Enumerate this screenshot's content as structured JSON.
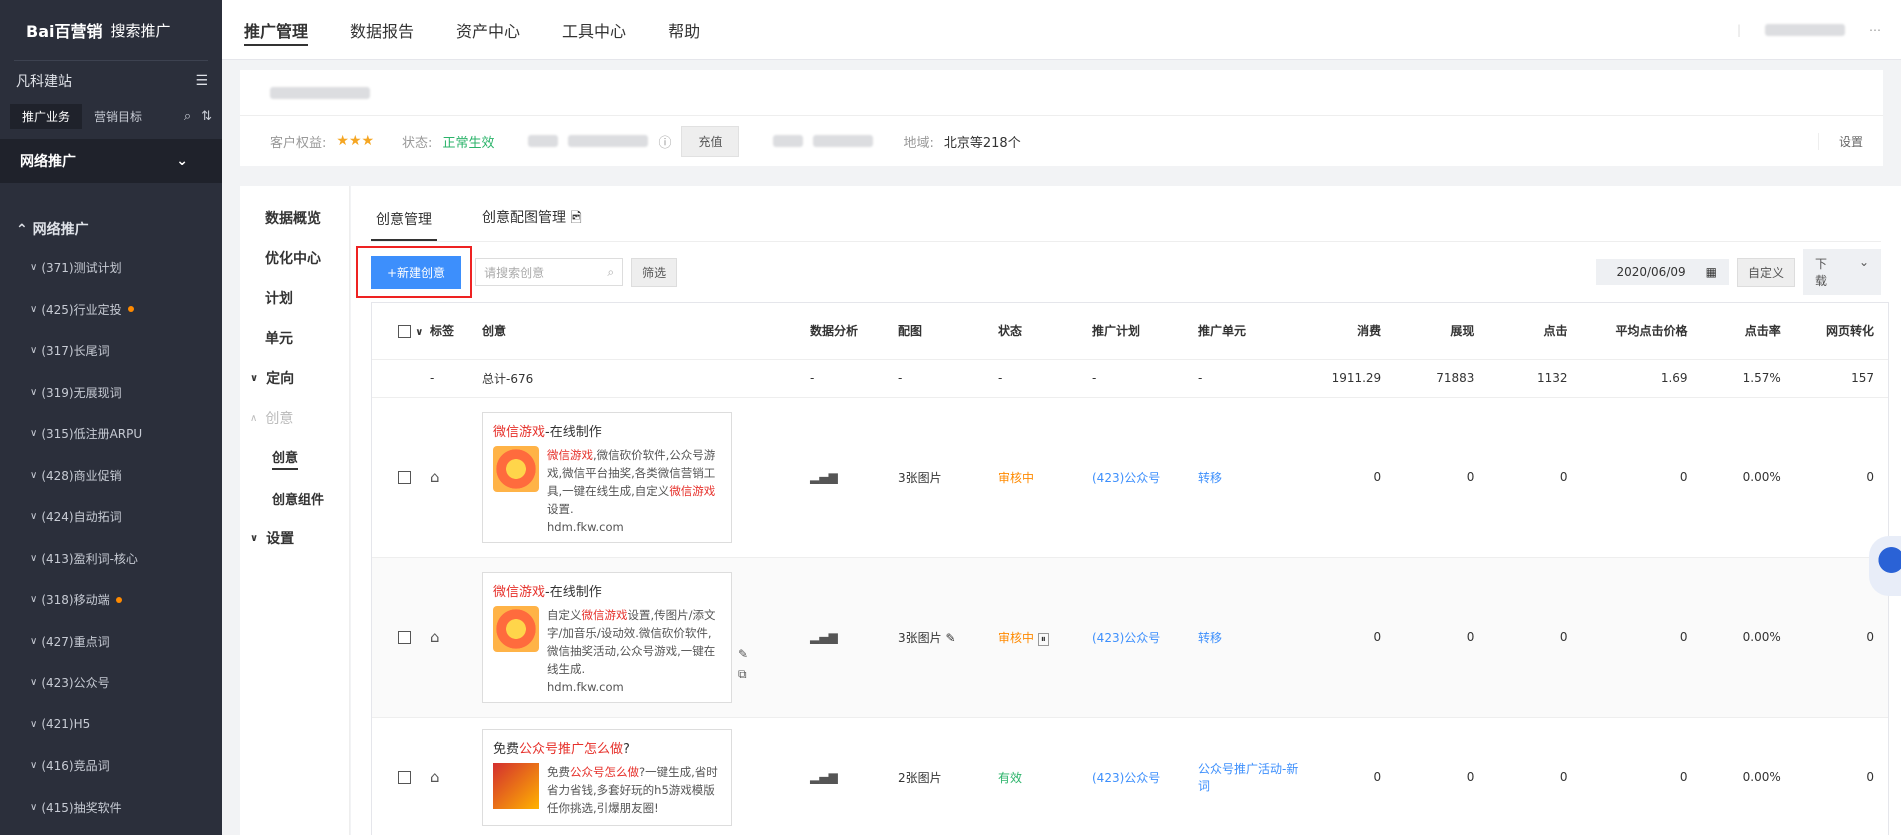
{
  "brand": {
    "logo_text": "Bai百营销",
    "product": "搜索推广"
  },
  "sidebar": {
    "site_name": "凡科建站",
    "tabs": [
      "推广业务",
      "营销目标"
    ],
    "section": "网络推广",
    "group": "网络推广",
    "items": [
      {
        "label": "(371)测试计划",
        "dot": false
      },
      {
        "label": "(425)行业定投",
        "dot": true
      },
      {
        "label": "(317)长尾词",
        "dot": false
      },
      {
        "label": "(319)无展现词",
        "dot": false
      },
      {
        "label": "(315)低注册ARPU",
        "dot": false
      },
      {
        "label": "(428)商业促销",
        "dot": false
      },
      {
        "label": "(424)自动拓词",
        "dot": false
      },
      {
        "label": "(413)盈利词-核心",
        "dot": false
      },
      {
        "label": "(318)移动端",
        "dot": true
      },
      {
        "label": "(427)重点词",
        "dot": false
      },
      {
        "label": "(423)公众号",
        "dot": false
      },
      {
        "label": "(421)H5",
        "dot": false
      },
      {
        "label": "(416)竞品词",
        "dot": false
      },
      {
        "label": "(415)抽奖软件",
        "dot": false
      }
    ]
  },
  "topnav": {
    "items": [
      "推广管理",
      "数据报告",
      "资产中心",
      "工具中心",
      "帮助"
    ]
  },
  "account": {
    "rights_label": "客户权益:",
    "status_label": "状态:",
    "status_value": "正常生效",
    "recharge": "充值",
    "region_label": "地域:",
    "region_value": "北京等218个",
    "settings": "设置"
  },
  "subnav": {
    "items": [
      "数据概览",
      "优化中心",
      "计划",
      "单元",
      "定向",
      "创意",
      "创意",
      "创意组件",
      "设置"
    ]
  },
  "main": {
    "tabs": [
      "创意管理",
      "创意配图管理"
    ],
    "new_button": "+新建创意",
    "search_placeholder": "请搜索创意",
    "filter_button": "筛选",
    "date": "2020/06/09",
    "custom_button": "自定义",
    "download_button": "下载"
  },
  "table": {
    "headers": [
      "标签",
      "创意",
      "数据分析",
      "配图",
      "状态",
      "推广计划",
      "推广单元",
      "消费",
      "展现",
      "点击",
      "平均点击价格",
      "点击率",
      "网页转化"
    ],
    "total": {
      "tag": "-",
      "idea": "总计-676",
      "analysis": "-",
      "img": "-",
      "status": "-",
      "plan": "-",
      "unit": "-",
      "cost": "1911.29",
      "impr": "71883",
      "click": "1132",
      "cpc": "1.69",
      "ctr": "1.57%",
      "conv": "157"
    },
    "rows": [
      {
        "title_red": "微信游戏",
        "title_rest": "-在线制作",
        "desc": [
          {
            "t": "微信游戏",
            "red": true
          },
          {
            "t": ",微信砍价软件,公众号游戏,微信平台抽奖,各类微信营销工具,一键在线生成,自定义",
            "red": false
          },
          {
            "t": "微信游戏",
            "red": true
          },
          {
            "t": "设置.",
            "red": false
          }
        ],
        "url": "hdm.fkw.com",
        "img": "3张图片",
        "status": "审核中",
        "plan": "(423)公众号",
        "unit": "转移",
        "cost": "0",
        "impr": "0",
        "click": "0",
        "cpc": "0",
        "ctr": "0.00%",
        "conv": "0"
      },
      {
        "title_red": "微信游戏",
        "title_rest": "-在线制作",
        "desc": [
          {
            "t": "自定义",
            "red": false
          },
          {
            "t": "微信游戏",
            "red": true
          },
          {
            "t": "设置,传图片/添文字/加音乐/设动效.微信砍价软件,微信抽奖活动,公众号游戏,一键在线生成.",
            "red": false
          }
        ],
        "url": "hdm.fkw.com",
        "img": "3张图片",
        "status": "审核中",
        "plan": "(423)公众号",
        "unit": "转移",
        "cost": "0",
        "impr": "0",
        "click": "0",
        "cpc": "0",
        "ctr": "0.00%",
        "conv": "0"
      },
      {
        "title_pre": "免费",
        "title_red": "公众号推广怎么做",
        "title_rest": "?",
        "desc": [
          {
            "t": "免费",
            "red": false
          },
          {
            "t": "公众号怎么做",
            "red": true
          },
          {
            "t": "?一键生成,省时省力省钱,多套好玩的h5游戏模版任你挑选,引爆朋友圈!",
            "red": false
          }
        ],
        "img": "2张图片",
        "status": "有效",
        "plan": "(423)公众号",
        "unit": "公众号推广活动-新词",
        "cost": "0",
        "impr": "0",
        "click": "0",
        "cpc": "0",
        "ctr": "0.00%",
        "conv": "0"
      }
    ]
  }
}
